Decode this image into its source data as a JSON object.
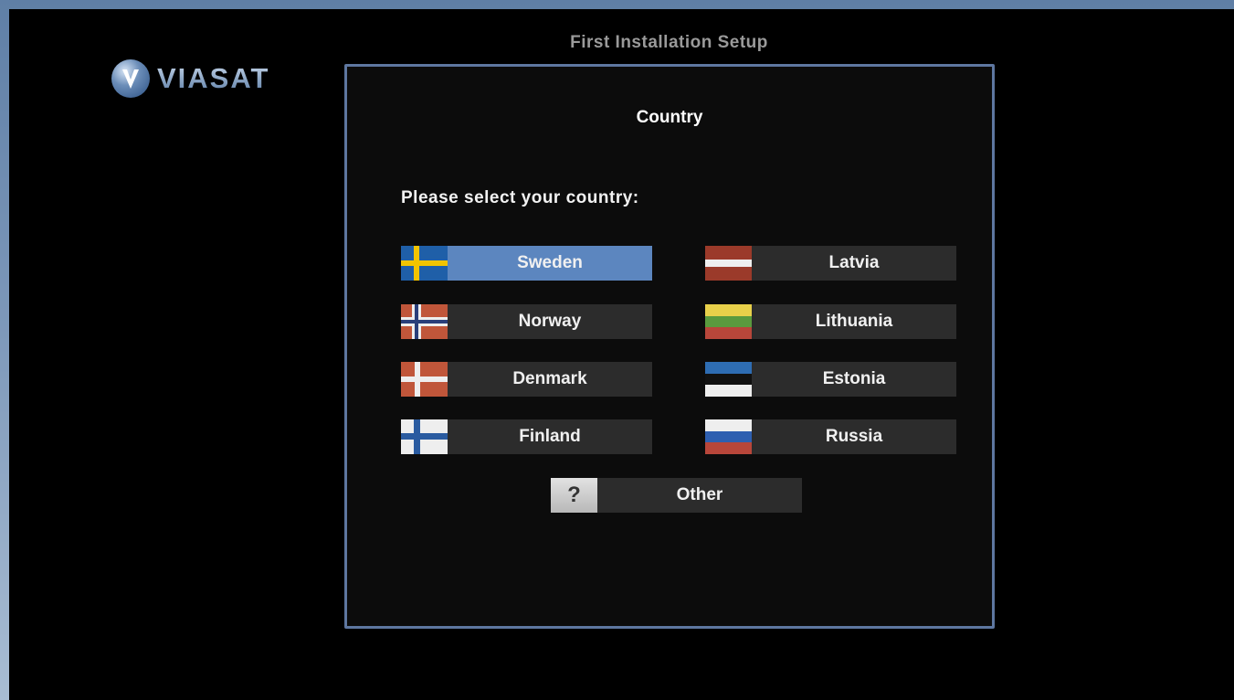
{
  "header": {
    "brand": "VIASAT",
    "title": "First Installation Setup"
  },
  "panel": {
    "title": "Country",
    "prompt": "Please select your country:"
  },
  "countries": [
    {
      "label": "Sweden",
      "flag": "sweden-flag",
      "selected": true
    },
    {
      "label": "Latvia",
      "flag": "latvia-flag",
      "selected": false
    },
    {
      "label": "Norway",
      "flag": "norway-flag",
      "selected": false
    },
    {
      "label": "Lithuania",
      "flag": "lithuania-flag",
      "selected": false
    },
    {
      "label": "Denmark",
      "flag": "denmark-flag",
      "selected": false
    },
    {
      "label": "Estonia",
      "flag": "estonia-flag",
      "selected": false
    },
    {
      "label": "Finland",
      "flag": "finland-flag",
      "selected": false
    },
    {
      "label": "Russia",
      "flag": "russia-flag",
      "selected": false
    }
  ],
  "other": {
    "label": "Other",
    "icon_text": "?"
  },
  "colors": {
    "selected": "#5c86bf",
    "button": "#2c2c2c",
    "panel_border": "#5e77a0"
  }
}
